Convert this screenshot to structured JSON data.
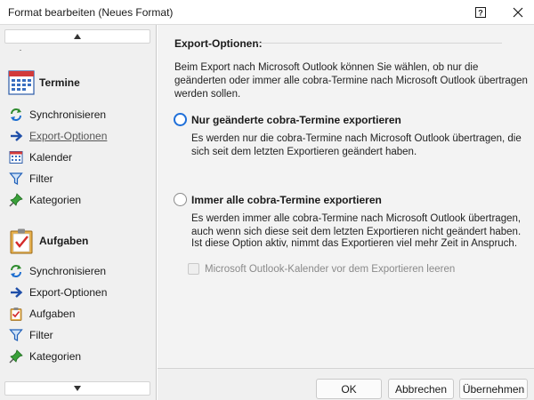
{
  "window": {
    "title": "Format bearbeiten (Neues Format)",
    "help_icon": "help-question-icon",
    "close_icon": "close-icon"
  },
  "sidebar": {
    "scroll_up_icon": "triangle-up-icon",
    "scroll_down_icon": "triangle-down-icon",
    "groups": [
      {
        "label": "Termine",
        "icon": "calendar-large-icon",
        "items": [
          {
            "label": "Synchronisieren",
            "icon": "sync-icon"
          },
          {
            "label": "Export-Optionen",
            "icon": "arrow-right-icon",
            "selected": true
          },
          {
            "label": "Kalender",
            "icon": "calendar-icon"
          },
          {
            "label": "Filter",
            "icon": "filter-icon"
          },
          {
            "label": "Kategorien",
            "icon": "pin-icon"
          }
        ]
      },
      {
        "label": "Aufgaben",
        "icon": "tasks-large-icon",
        "items": [
          {
            "label": "Synchronisieren",
            "icon": "sync-icon"
          },
          {
            "label": "Export-Optionen",
            "icon": "arrow-right-icon"
          },
          {
            "label": "Aufgaben",
            "icon": "tasks-icon"
          },
          {
            "label": "Filter",
            "icon": "filter-icon"
          },
          {
            "label": "Kategorien",
            "icon": "pin-icon"
          }
        ]
      }
    ]
  },
  "main": {
    "section_title": "Export-Optionen:",
    "intro": "Beim Export nach Microsoft Outlook können Sie wählen, ob nur die geänderten oder immer alle cobra-Termine nach Microsoft Outlook übertragen werden sollen.",
    "options": [
      {
        "label": "Nur geänderte cobra-Termine exportieren",
        "checked": true,
        "description": "Es werden nur die cobra-Termine nach Microsoft Outlook übertragen, die sich seit dem letzten Exportieren geändert haben."
      },
      {
        "label": "Immer alle cobra-Termine exportieren",
        "checked": false,
        "description_1": "Es werden immer alle cobra-Termine nach Microsoft Outlook übertragen, auch wenn sich diese seit dem letzten Exportieren nicht geändert haben.",
        "description_2": "Ist diese Option aktiv, nimmt das Exportieren viel mehr Zeit in Anspruch."
      }
    ],
    "checkbox": {
      "label": "Microsoft Outlook-Kalender vor dem Exportieren leeren",
      "checked": false,
      "disabled": true
    }
  },
  "footer": {
    "ok": "OK",
    "cancel": "Abbrechen",
    "apply": "Übernehmen"
  },
  "colors": {
    "accent": "#1e6fd9",
    "sidebar_bg": "#f0f0f0",
    "content_bg": "#f3f3f3"
  }
}
